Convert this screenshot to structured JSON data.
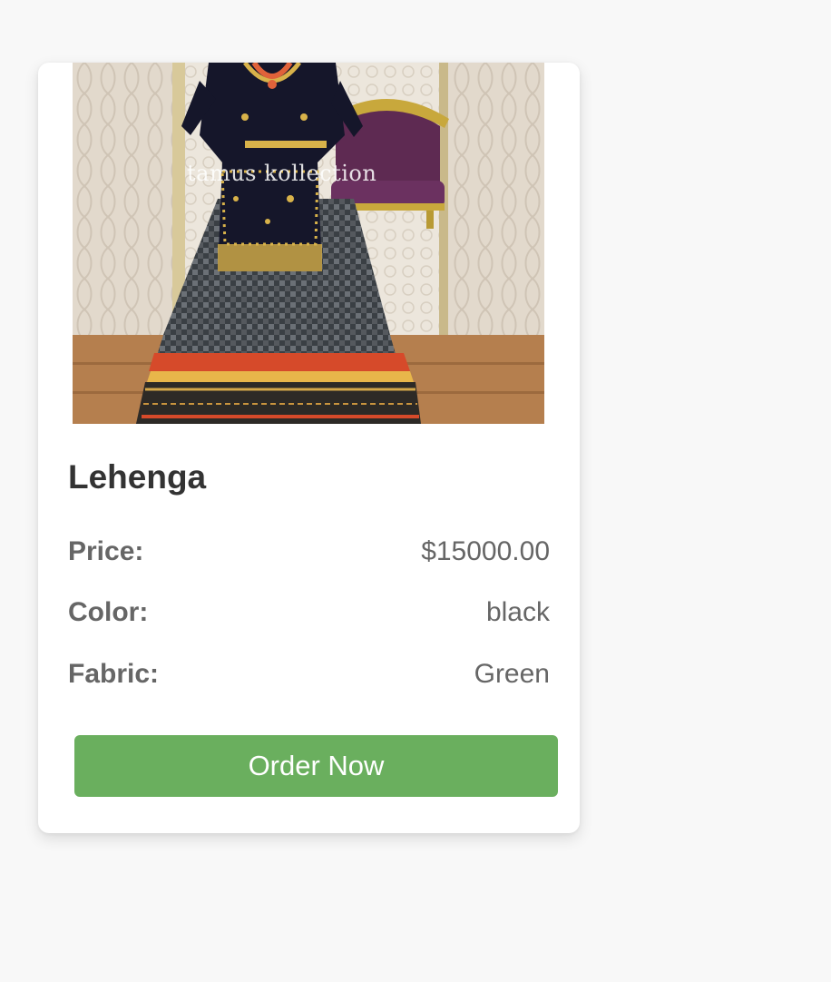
{
  "product": {
    "name": "Lehenga",
    "image_watermark": "tamus kollection",
    "details": [
      {
        "label": "Price:",
        "value": "$15000.00"
      },
      {
        "label": "Color:",
        "value": "black"
      },
      {
        "label": "Fabric:",
        "value": "Green"
      }
    ],
    "order_button_label": "Order Now"
  },
  "colors": {
    "page_background": "#f8f8f8",
    "card_background": "#ffffff",
    "button_background": "#6aaf5e",
    "title_text": "#333333",
    "detail_text": "#666666"
  }
}
